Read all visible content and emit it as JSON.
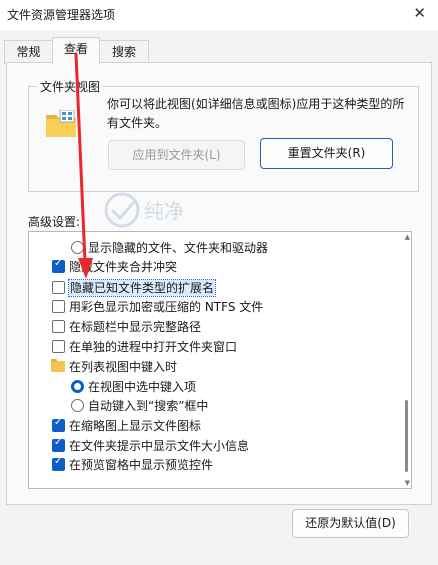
{
  "window": {
    "title": "文件资源管理器选项",
    "close_glyph": "✕"
  },
  "tabs": [
    {
      "label": "常规",
      "active": false
    },
    {
      "label": "查看",
      "active": true
    },
    {
      "label": "搜索",
      "active": false
    }
  ],
  "folder_views": {
    "legend": "文件夹视图",
    "icon": "folder-grid-icon",
    "description": "你可以将此视图(如详细信息或图标)应用于这种类型的所有文件夹。",
    "apply_button": "应用到文件夹(L)",
    "apply_enabled": false,
    "reset_button": "重置文件夹(R)"
  },
  "advanced": {
    "label": "高级设置:",
    "items": [
      {
        "kind": "radio",
        "checked": false,
        "indent": 1,
        "label": "显示隐藏的文件、文件夹和驱动器"
      },
      {
        "kind": "checkbox",
        "checked": true,
        "indent": 0,
        "label": "隐藏文件夹合并冲突"
      },
      {
        "kind": "checkbox",
        "checked": false,
        "indent": 0,
        "label": "隐藏已知文件类型的扩展名",
        "highlighted": true
      },
      {
        "kind": "checkbox",
        "checked": false,
        "indent": 0,
        "label": "用彩色显示加密或压缩的 NTFS 文件"
      },
      {
        "kind": "checkbox",
        "checked": false,
        "indent": 0,
        "label": "在标题栏中显示完整路径"
      },
      {
        "kind": "checkbox",
        "checked": false,
        "indent": 0,
        "label": "在单独的进程中打开文件夹窗口"
      },
      {
        "kind": "folder",
        "indent": 0,
        "label": "在列表视图中键入时"
      },
      {
        "kind": "radio",
        "checked": true,
        "indent": 1,
        "label": "在视图中选中键入项"
      },
      {
        "kind": "radio",
        "checked": false,
        "indent": 1,
        "label": "自动键入到“搜索”框中"
      },
      {
        "kind": "checkbox",
        "checked": true,
        "indent": 0,
        "label": "在缩略图上显示文件图标"
      },
      {
        "kind": "checkbox",
        "checked": true,
        "indent": 0,
        "label": "在文件夹提示中显示文件大小信息"
      },
      {
        "kind": "checkbox",
        "checked": true,
        "indent": 0,
        "label": "在预览窗格中显示预览控件"
      }
    ],
    "scroll_position": 0.67
  },
  "restore_button": "还原为默认值(D)",
  "watermark_text": "纯净",
  "accent_color": "#0c5fc5",
  "annotation_arrow_color": "#e8292c"
}
